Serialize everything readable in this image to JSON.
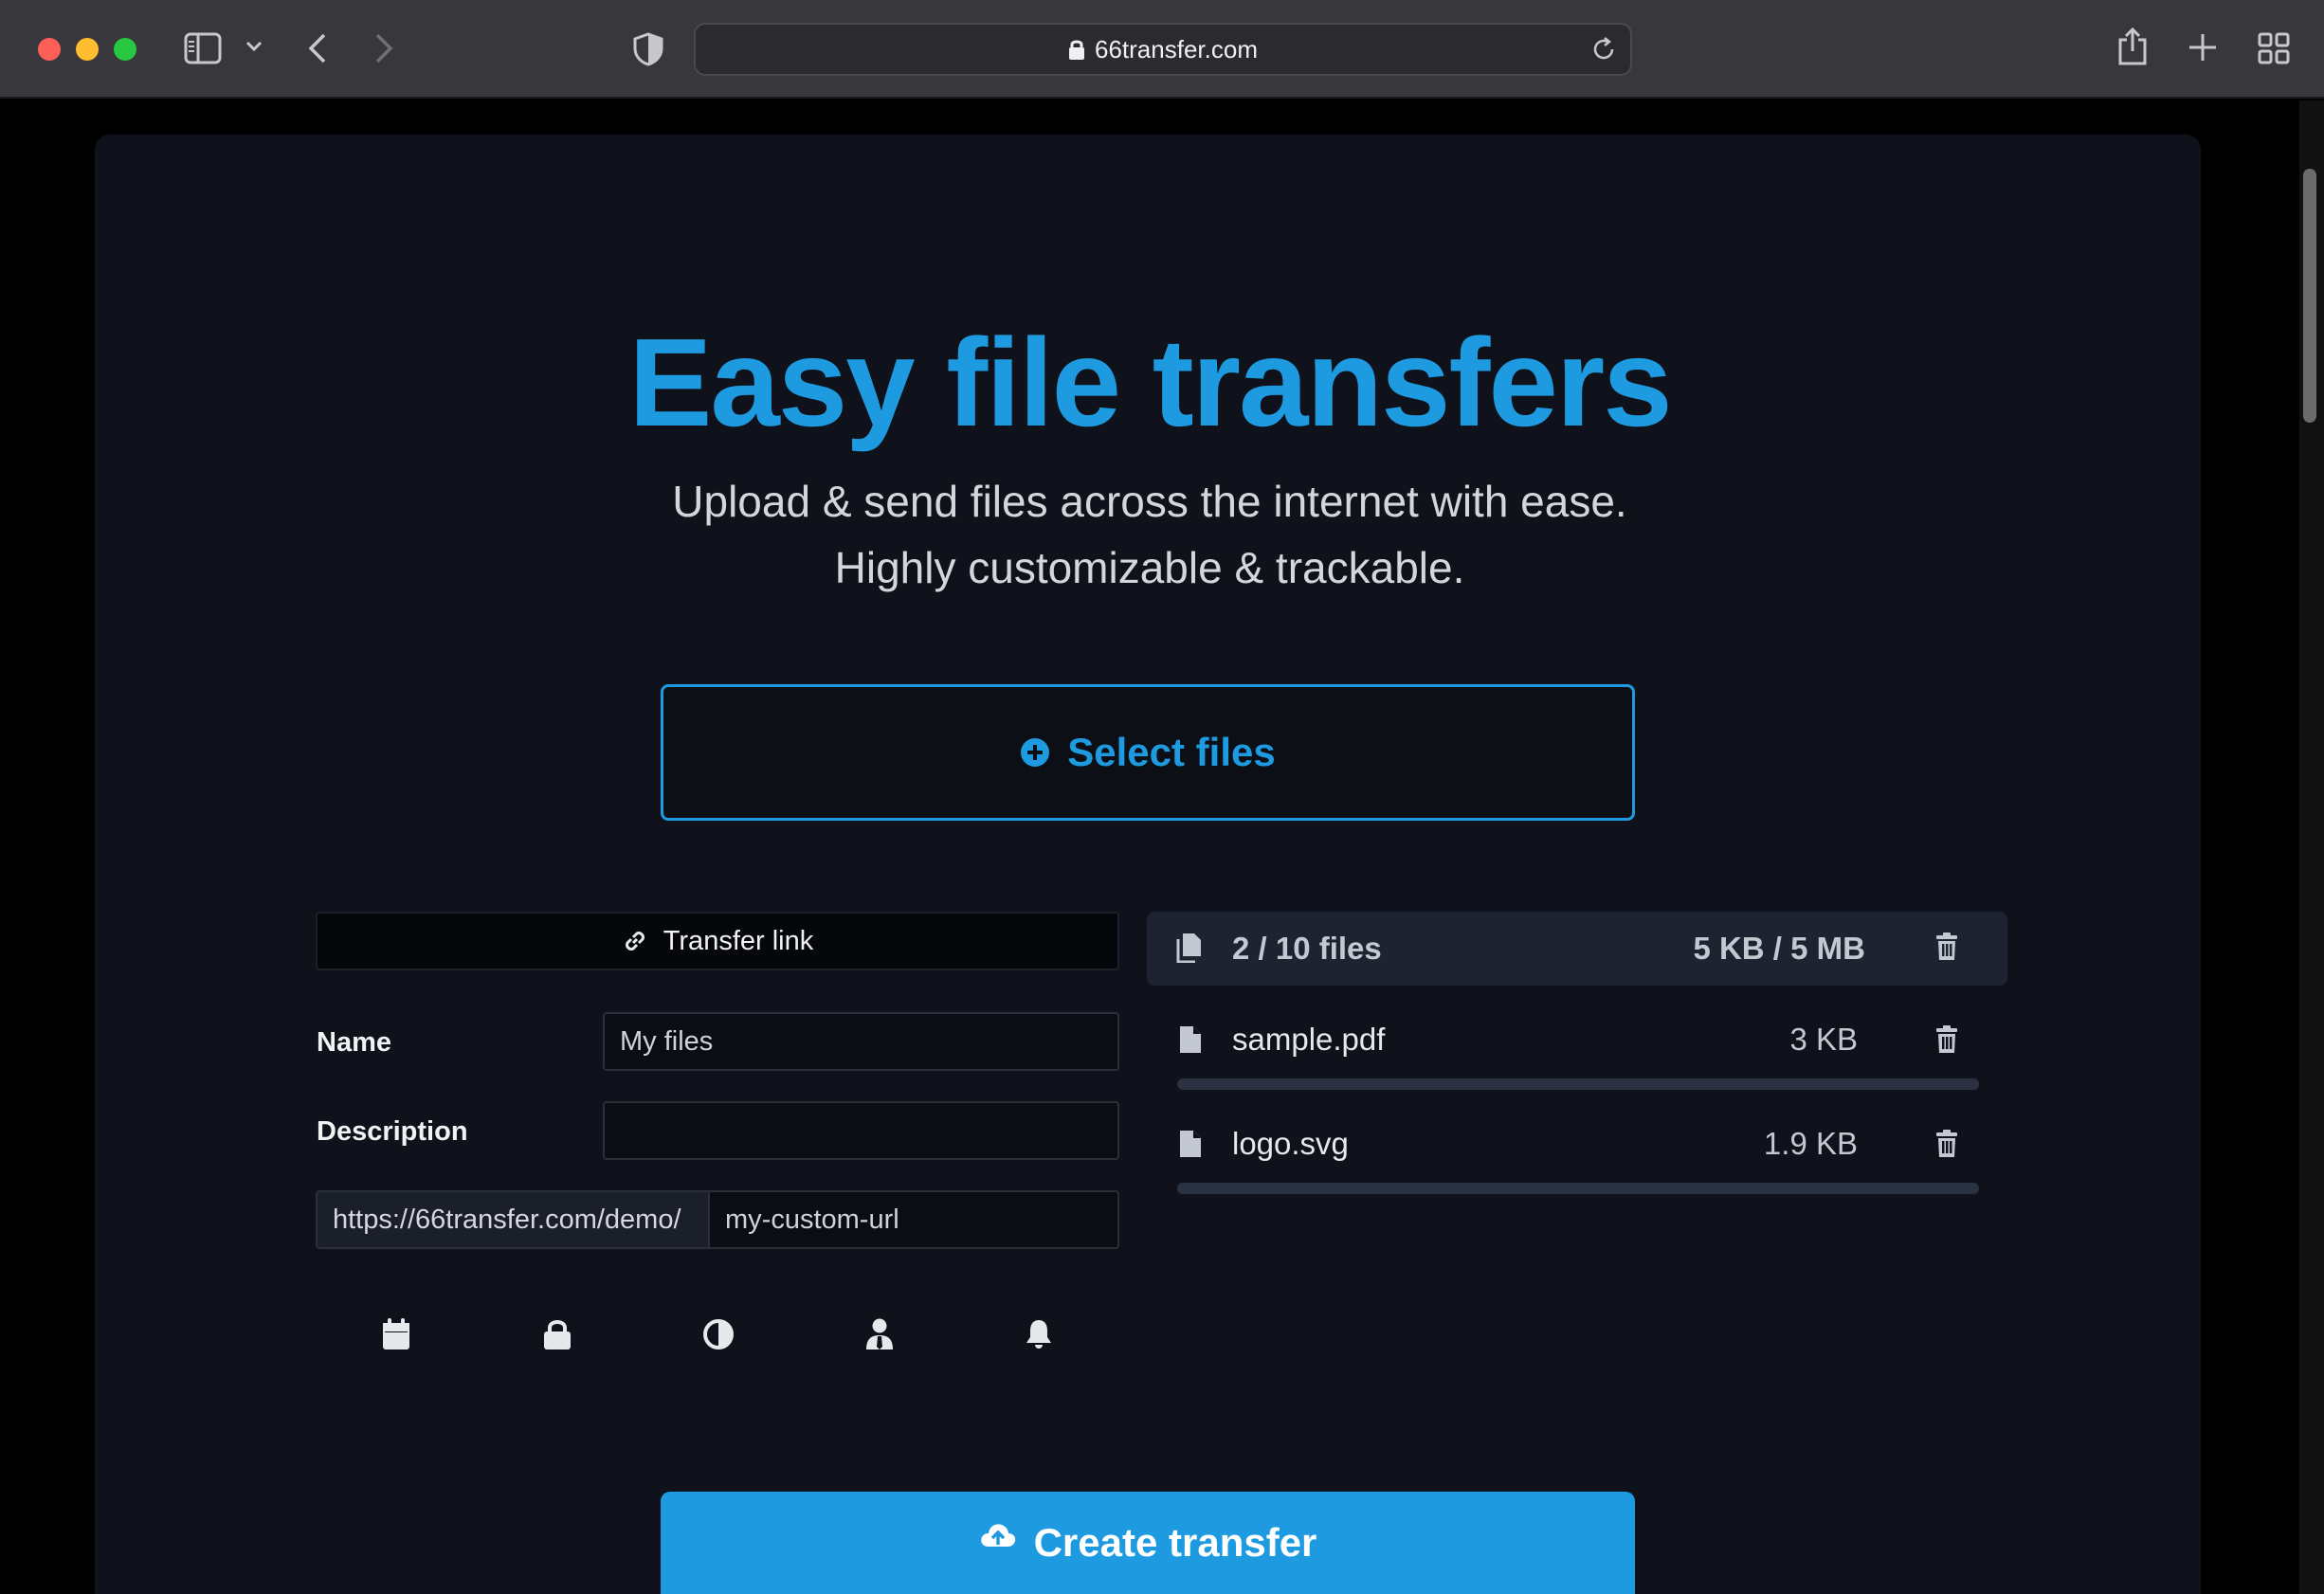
{
  "browser": {
    "url": "66transfer.com"
  },
  "hero": {
    "title": "Easy file transfers",
    "subtitle_line1": "Upload & send files across the internet with ease.",
    "subtitle_line2": "Highly customizable & trackable."
  },
  "select_files": {
    "label": "Select files"
  },
  "form": {
    "tab_label": "Transfer link",
    "name_label": "Name",
    "name_value": "My files",
    "description_label": "Description",
    "description_value": "",
    "url_prefix": "https://66transfer.com/demo/",
    "url_slug_value": "my-custom-url",
    "option_icons": [
      "calendar-icon",
      "lock-icon",
      "contrast-icon",
      "user-tie-icon",
      "bell-icon"
    ]
  },
  "files": {
    "count_text": "2 / 10 files",
    "size_text": "5 KB / 5 MB",
    "items": [
      {
        "name": "sample.pdf",
        "size": "3 KB",
        "progress": 0
      },
      {
        "name": "logo.svg",
        "size": "1.9 KB",
        "progress": 0
      }
    ]
  },
  "create": {
    "label": "Create transfer"
  },
  "colors": {
    "accent": "#1e9be0",
    "card_bg": "#0f121a"
  }
}
